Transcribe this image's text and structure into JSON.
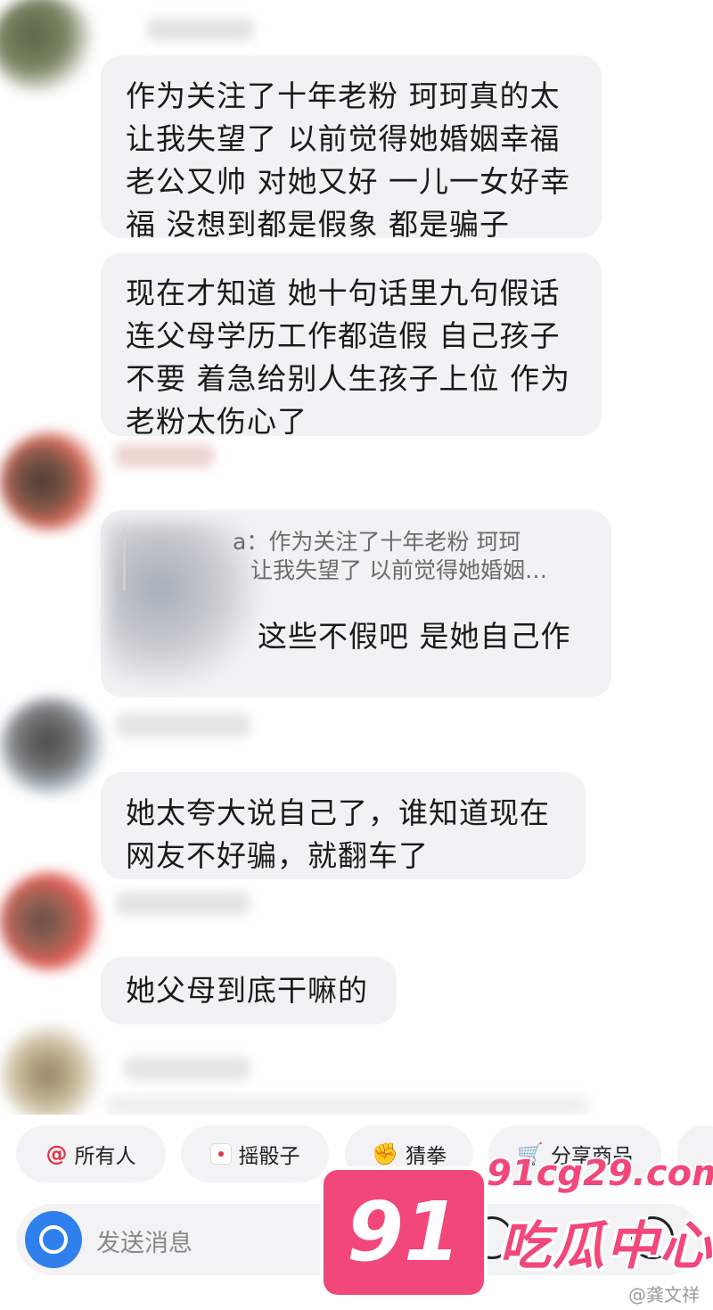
{
  "messages": [
    {
      "lines": [
        "作为关注了十年老粉 珂珂真的太",
        "让我失望了 以前觉得她婚姻幸福",
        "老公又帅 对她又好 一儿一女好幸",
        "福 没想到都是假象 都是骗子"
      ]
    },
    {
      "lines": [
        "现在才知道 她十句话里九句假话",
        "连父母学历工作都造假 自己孩子",
        "不要 着急给别人生孩子上位 作为",
        "老粉太伤心了"
      ]
    },
    {
      "quote_lines": [
        "a：作为关注了十年老粉 珂珂",
        "让我失望了 以前觉得她婚姻…"
      ],
      "lines": [
        "这些不假吧 是她自己作"
      ]
    },
    {
      "lines": [
        "她太夸大说自己了，谁知道现在",
        "网友不好骗，就翻车了"
      ]
    },
    {
      "lines": [
        "她父母到底干嘛的"
      ]
    }
  ],
  "quick_actions": [
    {
      "icon": "at-icon",
      "label": "所有人"
    },
    {
      "icon": "dice-icon",
      "label": "摇骰子"
    },
    {
      "icon": "fist-icon",
      "label": "猜拳"
    },
    {
      "icon": "cart-icon",
      "label": "分享商品"
    }
  ],
  "composer": {
    "placeholder": "发送消息"
  },
  "watermark": {
    "badge": "91",
    "url": "91cg29.com",
    "site_name": "吃瓜中心",
    "weibo": "@龚文祥"
  },
  "colors": {
    "bubble": "#f2f2f4",
    "accent_pink": "#f2477a",
    "camera_blue": "#2f80ed",
    "at_red": "#e0344a"
  }
}
